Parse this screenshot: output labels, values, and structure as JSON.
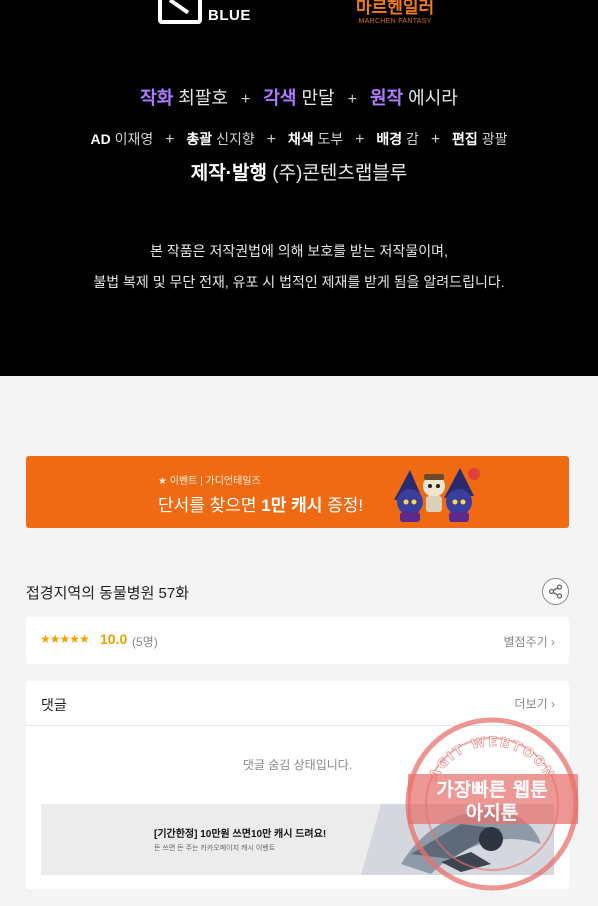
{
  "logos": {
    "publisher": "BLUE",
    "imprint_kr": "마르헨일러",
    "imprint_en": "MARCHEN FANTASY"
  },
  "credits": {
    "line1": [
      {
        "role": "작화",
        "name": "최팔호"
      },
      {
        "role": "각색",
        "name": "만달"
      },
      {
        "role": "원작",
        "name": "에시라"
      }
    ],
    "plus": "+",
    "line2": [
      {
        "role": "AD",
        "name": "이재영"
      },
      {
        "role": "총괄",
        "name": "신지향"
      },
      {
        "role": "채색",
        "name": "도부"
      },
      {
        "role": "배경",
        "name": "감"
      },
      {
        "role": "편집",
        "name": "광팔"
      }
    ],
    "line3": {
      "role": "제작·발행",
      "name": "(주)콘텐츠랩블루"
    },
    "notice_1": "본 작품은 저작권법에 의해 보호를 받는 저작물이며,",
    "notice_2": "불법 복제 및 무단 전재, 유포 시 법적인 제재를 받게 됨을 알려드립니다."
  },
  "banner": {
    "tag": "★ 이벤트 | 가디언테일즈",
    "text_1": "단서를 찾으면 ",
    "text_bold": "1만 캐시",
    "text_2": " 증정!",
    "color": "#f06a14"
  },
  "episode": {
    "title": "접경지역의 동물병원 57화",
    "share_icon": "share-icon"
  },
  "rating": {
    "stars": "★★★★★",
    "score": "10.0",
    "votes": "(5명)",
    "rate_button": "별점주기 ›"
  },
  "comments": {
    "title": "댓글",
    "more": "더보기 ›",
    "hidden_message": "댓글 숨김 상태입니다.",
    "ad_title": "[기간한정] 10만원 쓰면10만 캐시 드려요!",
    "ad_sub": "돈 쓰면 돈 주는 카카오페이지 캐시 이벤트"
  },
  "watermark": {
    "ring_text": "AGIT WEBTOON",
    "line1": "가장빠른 웹툰",
    "line2": "아지툰",
    "color": "#e8706c"
  }
}
